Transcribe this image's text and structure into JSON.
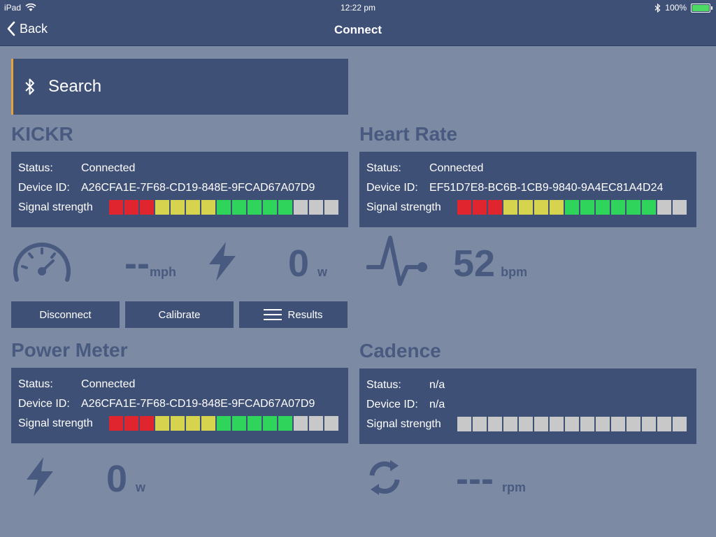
{
  "status_bar": {
    "device": "iPad",
    "time": "12:22 pm",
    "battery": "100%",
    "battery_level": 1.0
  },
  "nav": {
    "back_label": "Back",
    "title": "Connect"
  },
  "search": {
    "label": "Search"
  },
  "colors": {
    "bar_red": "#e0252e",
    "bar_yellow": "#d6d44e",
    "bar_green": "#2fd55b",
    "bar_empty": "#c8c8c8",
    "navy": "#3f5077",
    "accent": "#e8a23a"
  },
  "kickr": {
    "title": "KICKR",
    "status_key": "Status:",
    "status": "Connected",
    "device_key": "Device ID:",
    "device_id": "A26CFA1E-7F68-CD19-848E-9FCAD67A07D9",
    "signal_key": "Signal strength",
    "signal": [
      "red",
      "red",
      "red",
      "yellow",
      "yellow",
      "yellow",
      "yellow",
      "green",
      "green",
      "green",
      "green",
      "green",
      "empty",
      "empty",
      "empty"
    ],
    "speed_value": "--",
    "speed_unit": "mph",
    "power_value": "0",
    "power_unit": "w",
    "buttons": {
      "disconnect": "Disconnect",
      "calibrate": "Calibrate",
      "results": "Results"
    }
  },
  "heart_rate": {
    "title": "Heart Rate",
    "status_key": "Status:",
    "status": "Connected",
    "device_key": "Device ID:",
    "device_id": "EF51D7E8-BC6B-1CB9-9840-9A4EC81A4D24",
    "signal_key": "Signal strength",
    "signal": [
      "red",
      "red",
      "red",
      "yellow",
      "yellow",
      "yellow",
      "yellow",
      "green",
      "green",
      "green",
      "green",
      "green",
      "green",
      "empty",
      "empty"
    ],
    "value": "52",
    "unit": "bpm"
  },
  "power_meter": {
    "title": "Power Meter",
    "status_key": "Status:",
    "status": "Connected",
    "device_key": "Device ID:",
    "device_id": "A26CFA1E-7F68-CD19-848E-9FCAD67A07D9",
    "signal_key": "Signal strength",
    "signal": [
      "red",
      "red",
      "red",
      "yellow",
      "yellow",
      "yellow",
      "yellow",
      "green",
      "green",
      "green",
      "green",
      "green",
      "empty",
      "empty",
      "empty"
    ],
    "value": "0",
    "unit": "w"
  },
  "cadence": {
    "title": "Cadence",
    "status_key": "Status:",
    "status": "n/a",
    "device_key": "Device ID:",
    "device_id": "n/a",
    "signal_key": "Signal strength",
    "signal": [
      "empty",
      "empty",
      "empty",
      "empty",
      "empty",
      "empty",
      "empty",
      "empty",
      "empty",
      "empty",
      "empty",
      "empty",
      "empty",
      "empty",
      "empty"
    ],
    "value": "---",
    "unit": "rpm"
  }
}
